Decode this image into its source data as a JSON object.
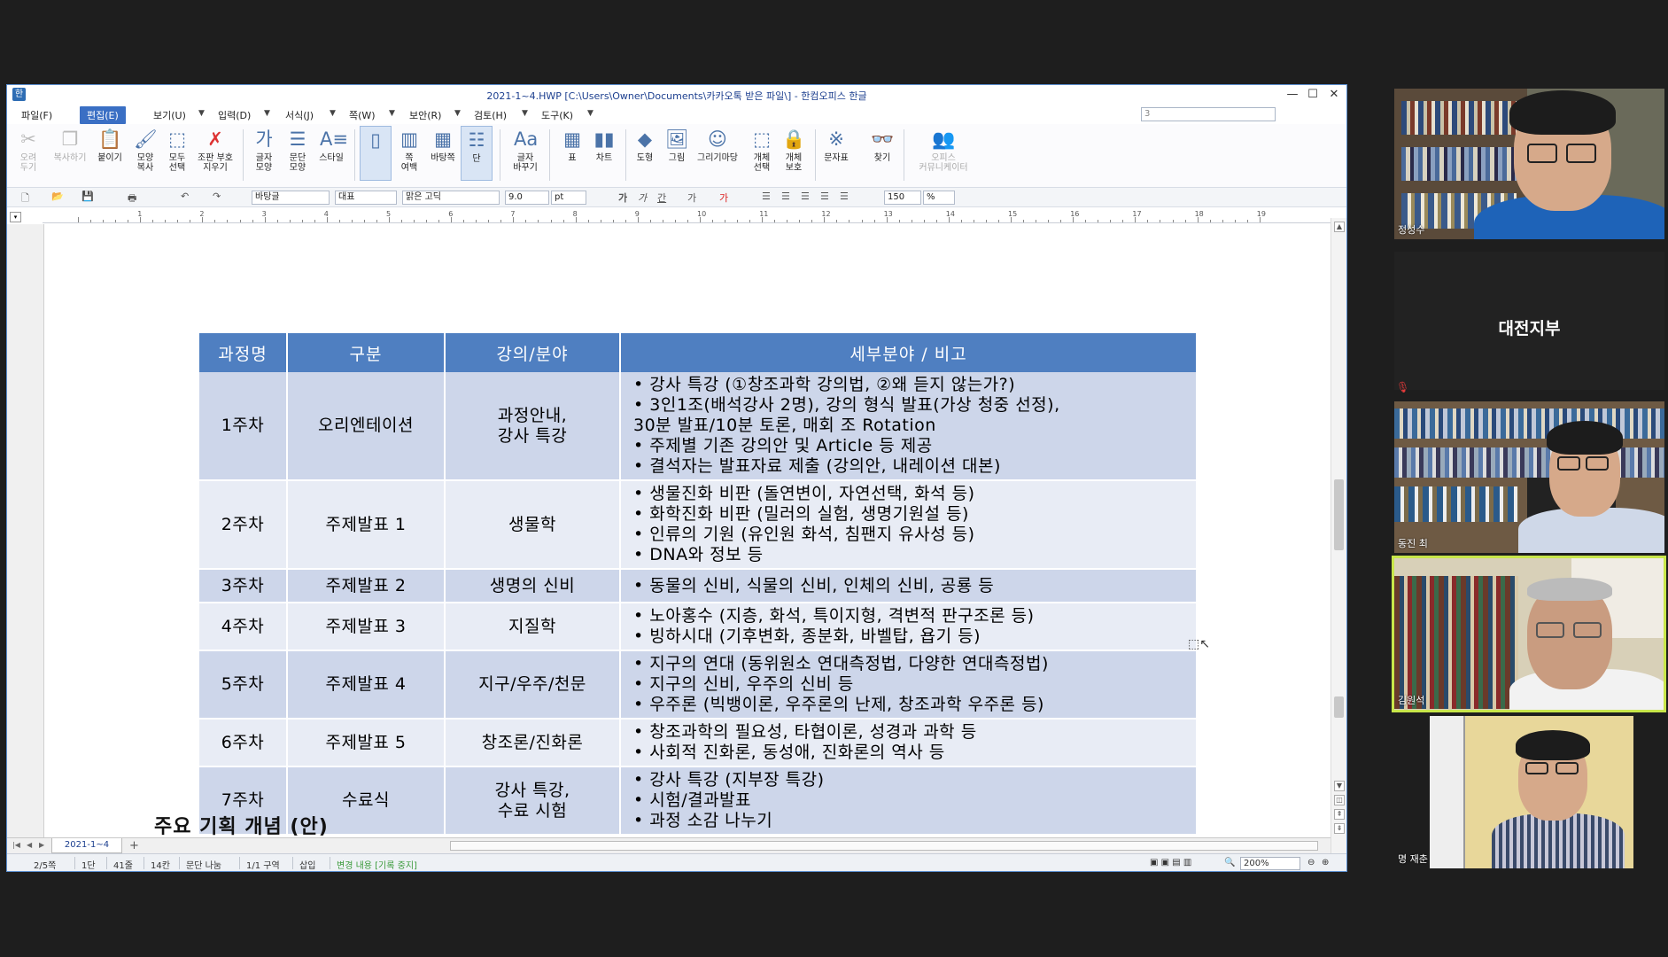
{
  "window": {
    "title": "2021-1~4.HWP [C:\\Users\\Owner\\Documents\\카카오톡 받은 파일\\] - 한컴오피스 한글",
    "doc_selector": "3"
  },
  "menu": [
    "파일(F)",
    "편집(E)",
    "보기(U)",
    "입력(D)",
    "서식(J)",
    "쪽(W)",
    "보안(R)",
    "검토(H)",
    "도구(K)"
  ],
  "toolbar": {
    "cut": "오려\n두기",
    "copy": "복사하기",
    "paste": "붙이기",
    "shape_copy": "모양\n복사",
    "select_all": "모두\n선택",
    "clear_format": "조판 부호\n지우기",
    "char_shape": "글자\n모양",
    "para_shape": "문단\n모양",
    "style": "스타일",
    "page_margin": "쪽\n여백",
    "background": "바탕쪽",
    "columns": "단",
    "char_change": "글자\n바꾸기",
    "table": "표",
    "chart": "차트",
    "shapes": "도형",
    "picture": "그림",
    "drawing": "그리기마당",
    "obj_select": "개체\n선택",
    "obj_protect": "개체\n보호",
    "char_table": "문자표",
    "find": "찾기",
    "community": "오피스\n커뮤니케이터"
  },
  "format_bar": {
    "style": "바탕글",
    "lang": "대표",
    "font": "맑은 고딕",
    "size": "9.0",
    "unit": "pt",
    "spacing": "150",
    "spacing_unit": "%"
  },
  "ruler_numbers": [
    "1",
    "2",
    "3",
    "4",
    "5",
    "6",
    "7",
    "8",
    "9",
    "10",
    "11",
    "12",
    "13",
    "14",
    "15",
    "16",
    "17",
    "18",
    "19"
  ],
  "table": {
    "headers": [
      "과정명",
      "구분",
      "강의/분야",
      "세부분야 / 비고"
    ],
    "rows": [
      {
        "week": "1주차",
        "type": "오리엔테이션",
        "field": "과정안내,\n강사 특강",
        "notes": [
          "강사 특강 (①창조과학 강의법, ②왜 듣지 않는가?)",
          "3인1조(배석강사 2명), 강의 형식 발표(가상 청중 선정),\n30분 발표/10분 토론, 매회 조 Rotation",
          "주제별 기존 강의안 및 Article 등 제공",
          "결석자는 발표자료 제출 (강의안, 내레이션 대본)"
        ]
      },
      {
        "week": "2주차",
        "type": "주제발표 1",
        "field": "생물학",
        "notes": [
          "생물진화 비판 (돌연변이, 자연선택, 화석 등)",
          "화학진화 비판 (밀러의 실험, 생명기원설 등)",
          "인류의 기원 (유인원 화석, 침팬지 유사성 등)",
          "DNA와 정보 등"
        ]
      },
      {
        "week": "3주차",
        "type": "주제발표 2",
        "field": "생명의 신비",
        "notes": [
          "동물의 신비, 식물의 신비, 인체의 신비, 공룡 등"
        ]
      },
      {
        "week": "4주차",
        "type": "주제발표 3",
        "field": "지질학",
        "notes": [
          "노아홍수 (지층, 화석, 특이지형, 격변적 판구조론 등)",
          "빙하시대 (기후변화, 종분화, 바벨탑, 욥기 등)"
        ]
      },
      {
        "week": "5주차",
        "type": "주제발표 4",
        "field": "지구/우주/천문",
        "notes": [
          "지구의 연대 (동위원소 연대측정법, 다양한 연대측정법)",
          "지구의 신비, 우주의 신비 등",
          "우주론 (빅뱅이론, 우주론의 난제, 창조과학 우주론 등)"
        ]
      },
      {
        "week": "6주차",
        "type": "주제발표 5",
        "field": "창조론/진화론",
        "notes": [
          "창조과학의 필요성, 타협이론, 성경과 과학 등",
          "사회적 진화론, 동성애, 진화론의 역사 등"
        ]
      },
      {
        "week": "7주차",
        "type": "수료식",
        "field": "강사 특강,\n수료 시험",
        "notes": [
          "강사 특강 (지부장 특강)",
          "시험/결과발표",
          "과정 소감 나누기"
        ]
      }
    ]
  },
  "section_heading": "주요 기획 개념 (안)",
  "tab": {
    "doc_tab": "2021-1~4"
  },
  "status": {
    "page": "2/5쪽",
    "column": "1단",
    "line": "41줄",
    "col": "14칸",
    "para": "문단 나눔",
    "section": "1/1 구역",
    "insert": "삽입",
    "track": "변경 내용 [기록 중지]",
    "zoom": "200%"
  },
  "participants": [
    {
      "name": "정성수"
    },
    {
      "name": "대전지부"
    },
    {
      "name": "동진 최"
    },
    {
      "name": "김원석"
    },
    {
      "name": "명 재춘"
    }
  ],
  "colors": {
    "header_blue": "#4f7fc1",
    "row_dark": "#cdd6ea",
    "row_light": "#e8ecf5",
    "active_speaker": "#c8e64a"
  }
}
